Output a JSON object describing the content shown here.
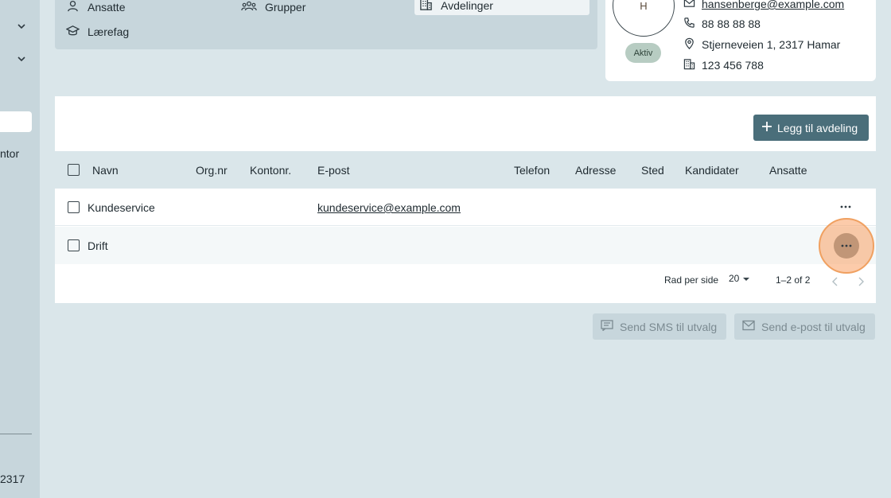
{
  "sidebar": {
    "partial_text_1": "ntor",
    "partial_text_2": "2317"
  },
  "nav": {
    "items": [
      {
        "label": "Ansatte",
        "icon": "person-icon"
      },
      {
        "label": "Grupper",
        "icon": "group-icon"
      },
      {
        "label": "Avdelinger",
        "icon": "building-icon"
      },
      {
        "label": "Lærefag",
        "icon": "graduation-cap-icon"
      }
    ]
  },
  "profile": {
    "avatar_initial": "H",
    "status": "Aktiv",
    "email": "hansenberge@example.com",
    "phone": "88 88 88 88",
    "address": "Stjerneveien 1, 2317 Hamar",
    "org_number": "123 456 788"
  },
  "table": {
    "add_button_label": "Legg til avdeling",
    "columns": [
      "Navn",
      "Org.nr",
      "Kontonr.",
      "E-post",
      "Telefon",
      "Adresse",
      "Sted",
      "Kandidater",
      "Ansatte"
    ],
    "rows": [
      {
        "name": "Kundeservice",
        "org_nr": "",
        "kontonr": "",
        "email": "kundeservice@example.com",
        "telefon": "",
        "adresse": "",
        "sted": "",
        "kandidater": "",
        "ansatte": ""
      },
      {
        "name": "Drift",
        "org_nr": "",
        "kontonr": "",
        "email": "",
        "telefon": "",
        "adresse": "",
        "sted": "",
        "kandidater": "",
        "ansatte": ""
      }
    ],
    "pagination": {
      "rows_per_page_label": "Rad per side",
      "rows_per_page_value": "20",
      "range": "1–2 of 2"
    }
  },
  "actions": {
    "send_sms": "Send SMS til utvalg",
    "send_email": "Send e-post til utvalg"
  },
  "colors": {
    "background": "#dae6ea",
    "sidebar": "#c7d6dc",
    "primary_button": "#4a6e7a",
    "highlight": "#f0a060"
  }
}
